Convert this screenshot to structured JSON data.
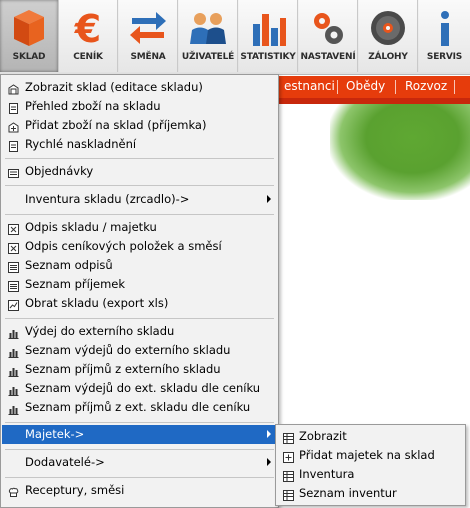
{
  "toolbar": {
    "items": [
      {
        "label": "SKLAD",
        "icon": "warehouse-icon"
      },
      {
        "label": "CENÍK",
        "icon": "euro-icon"
      },
      {
        "label": "SMĚNA",
        "icon": "exchange-arrows-icon"
      },
      {
        "label": "UŽIVATELÉ",
        "icon": "users-icon"
      },
      {
        "label": "STATISTIKY",
        "icon": "bar-chart-icon"
      },
      {
        "label": "NASTAVENÍ",
        "icon": "gear-icon"
      },
      {
        "label": "ZÁLOHY",
        "icon": "disc-icon"
      },
      {
        "label": "SERVIS",
        "icon": "info-icon"
      }
    ],
    "active_index": 0
  },
  "navbar": {
    "items": [
      "estnanci",
      "Obědy",
      "Rozvoz"
    ]
  },
  "menu": {
    "items": [
      {
        "label": "Zobrazit sklad (editace skladu)",
        "icon": "warehouse-small-icon"
      },
      {
        "label": "Přehled zboží na skladu",
        "icon": "document-icon"
      },
      {
        "label": "Přidat zboží na sklad (příjemka)",
        "icon": "add-stock-icon"
      },
      {
        "label": "Rychlé naskladnění",
        "icon": "document-icon"
      },
      {
        "label": "Objednávky",
        "icon": "orders-icon"
      },
      {
        "label": "Inventura skladu (zrcadlo)->",
        "icon": ""
      },
      {
        "label": "Odpis skladu / majetku",
        "icon": "writeoff-icon"
      },
      {
        "label": "Odpis ceníkových položek a směsí",
        "icon": "writeoff-icon"
      },
      {
        "label": "Seznam odpisů",
        "icon": "list-icon"
      },
      {
        "label": "Seznam příjemek",
        "icon": "list-icon"
      },
      {
        "label": "Obrat skladu (export xls)",
        "icon": "chart-icon"
      },
      {
        "label": "Výdej do externího skladu",
        "icon": "bars-icon"
      },
      {
        "label": "Seznam výdejů do externího skladu",
        "icon": "bars-icon"
      },
      {
        "label": "Seznam příjmů z externího skladu",
        "icon": "bars-icon"
      },
      {
        "label": "Seznam výdejů do ext. skladu dle ceníku",
        "icon": "bars-icon"
      },
      {
        "label": "Seznam příjmů z ext. skladu dle ceníku",
        "icon": "bars-icon"
      },
      {
        "label": "Majetek->",
        "icon": ""
      },
      {
        "label": "Dodavatelé->",
        "icon": ""
      },
      {
        "label": "Receptury, směsi",
        "icon": "chef-hat-icon"
      }
    ],
    "highlighted": "Majetek->"
  },
  "submenu": {
    "items": [
      {
        "label": "Zobrazit",
        "icon": "table-icon"
      },
      {
        "label": "Přidat majetek na sklad",
        "icon": "add-icon"
      },
      {
        "label": "Inventura",
        "icon": "table-icon"
      },
      {
        "label": "Seznam inventur",
        "icon": "table-icon"
      }
    ]
  },
  "colors": {
    "accent": "#1f69c4",
    "navbar": "#e63c0c",
    "icon_orange": "#e8551c",
    "icon_blue": "#2e6fb8"
  }
}
